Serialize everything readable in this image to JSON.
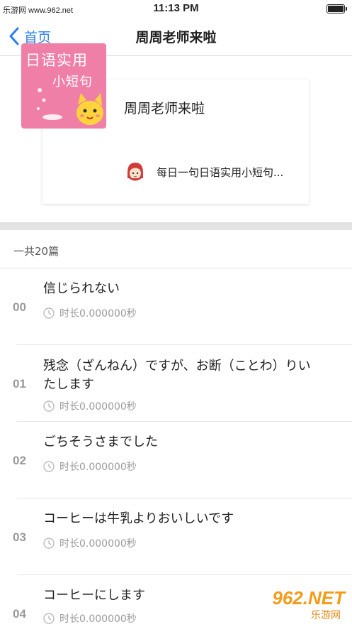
{
  "status_bar": {
    "source_text": "乐游网 www.962.net",
    "time": "11:13 PM"
  },
  "nav": {
    "back_label": "首页",
    "title": "周周老师来啦"
  },
  "album": {
    "cover_line1": "日语实用",
    "cover_line2": "小短句",
    "title": "周周老师来啦",
    "description": "每日一句日语实用小短句..."
  },
  "list_header": {
    "count_label": "一共20篇"
  },
  "tracks": [
    {
      "index": "00",
      "title": "信じられない",
      "duration": "时长0.000000秒"
    },
    {
      "index": "01",
      "title": "残念（ざんねん）ですが、お断（ことわ）りいたします",
      "duration": "时长0.000000秒"
    },
    {
      "index": "02",
      "title": "ごちそうさまでした",
      "duration": "时长0.000000秒"
    },
    {
      "index": "03",
      "title": "コーヒーは牛乳よりおいしいです",
      "duration": "时长0.000000秒"
    },
    {
      "index": "04",
      "title": "コーヒーにします",
      "duration": "时长0.000000秒"
    }
  ],
  "watermark": {
    "top": "962.NET",
    "bottom": "乐游网"
  },
  "colors": {
    "accent": "#2a7ff0",
    "cover_pink": "#f07fa8",
    "separator": "#e2e2e2",
    "muted": "#9a9a9a"
  },
  "icons": {
    "back": "chevron-left-icon",
    "clock": "clock-icon",
    "avatar": "author-avatar-icon"
  }
}
